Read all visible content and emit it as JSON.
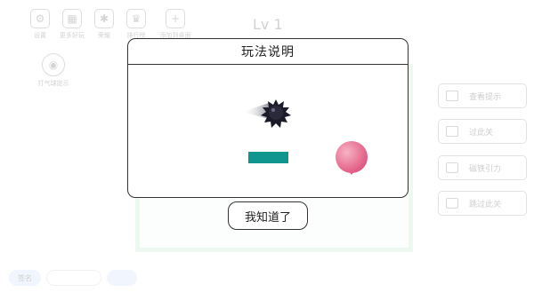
{
  "game": {
    "level": "Lv 1",
    "top_icons": [
      {
        "label": "设置",
        "icon": "gear-icon"
      },
      {
        "label": "更多好玩",
        "icon": "grid-icon"
      },
      {
        "label": "荣耀",
        "icon": "badge-icon"
      },
      {
        "label": "排行榜",
        "icon": "trophy-icon"
      },
      {
        "label": "添加到桌面",
        "icon": "add-desktop-icon"
      }
    ],
    "hint_label": "打气球提示",
    "side_buttons": [
      {
        "label": "查看提示",
        "icon": "video-icon"
      },
      {
        "label": "过此关",
        "icon": "video-icon"
      },
      {
        "label": "磁铁引力",
        "icon": "magnet-icon"
      },
      {
        "label": "跳过此关",
        "icon": "video-icon"
      }
    ],
    "bottom": {
      "badge": "签名"
    }
  },
  "dialog": {
    "title": "玩法说明",
    "confirm_label": "我知道了"
  },
  "colors": {
    "platform": "#11968f",
    "balloon_light": "#f5a0b8",
    "balloon_dark": "#e0557e",
    "spikeball": "#1b1b2a"
  }
}
